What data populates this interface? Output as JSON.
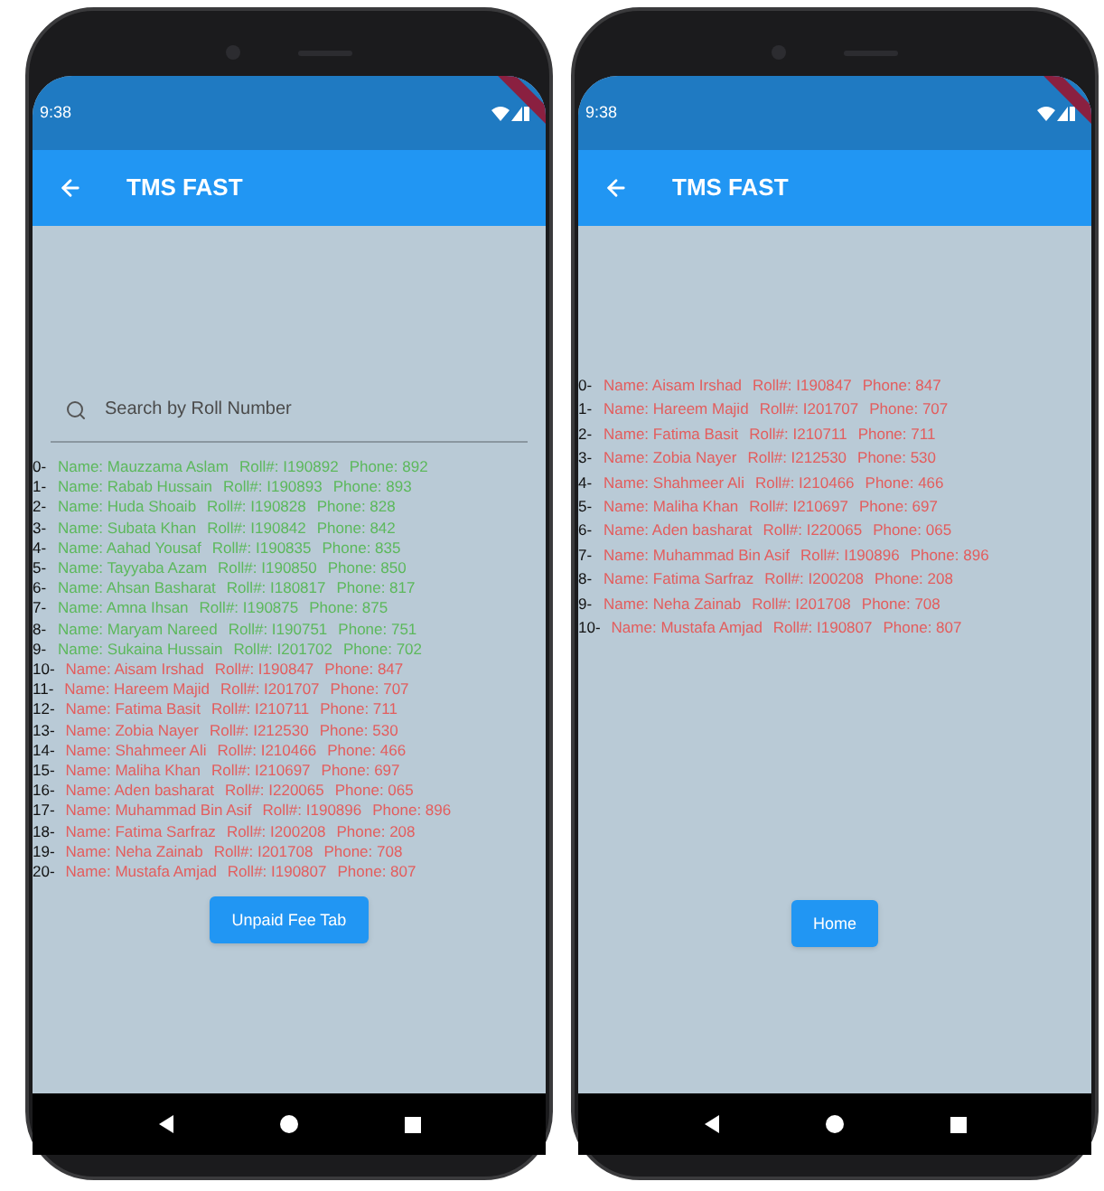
{
  "phones": [
    {
      "status_bar": {
        "time": "9:38"
      },
      "app_bar": {
        "title": "TMS FAST"
      },
      "search": {
        "placeholder": "Search by Roll Number"
      },
      "rows": [
        {
          "index": "0-",
          "name": "Name: Mauzzama Aslam",
          "roll": "Roll#: I190892",
          "phone": "Phone: 892",
          "color": "#5cb85c"
        },
        {
          "index": "1-",
          "name": "Name: Rabab Hussain",
          "roll": "Roll#: I190893",
          "phone": "Phone: 893",
          "color": "#5cb85c"
        },
        {
          "index": "2-",
          "name": "Name: Huda Shoaib",
          "roll": "Roll#: I190828",
          "phone": "Phone: 828",
          "color": "#5cb85c"
        },
        {
          "index": "3-",
          "name": "Name: Subata Khan",
          "roll": "Roll#: I190842",
          "phone": "Phone: 842",
          "color": "#5cb85c"
        },
        {
          "index": "4-",
          "name": "Name: Aahad Yousaf",
          "roll": "Roll#: I190835",
          "phone": "Phone: 835",
          "color": "#5cb85c"
        },
        {
          "index": "5-",
          "name": "Name: Tayyaba Azam",
          "roll": "Roll#: I190850",
          "phone": "Phone: 850",
          "color": "#5cb85c"
        },
        {
          "index": "6-",
          "name": "Name: Ahsan Basharat",
          "roll": "Roll#: I180817",
          "phone": "Phone: 817",
          "color": "#5cb85c"
        },
        {
          "index": "7-",
          "name": "Name: Amna Ihsan",
          "roll": "Roll#: I190875",
          "phone": "Phone: 875",
          "color": "#5cb85c"
        },
        {
          "index": "8-",
          "name": "Name: Maryam Nareed",
          "roll": "Roll#: I190751",
          "phone": "Phone: 751",
          "color": "#5cb85c"
        },
        {
          "index": "9-",
          "name": "Name: Sukaina Hussain",
          "roll": "Roll#: I201702",
          "phone": "Phone: 702",
          "color": "#5cb85c"
        },
        {
          "index": "10-",
          "name": "Name: Aisam Irshad",
          "roll": "Roll#: I190847",
          "phone": "Phone: 847",
          "color": "#e35d5d"
        },
        {
          "index": "11-",
          "name": "Name: Hareem Majid",
          "roll": "Roll#: I201707",
          "phone": "Phone: 707",
          "color": "#e35d5d"
        },
        {
          "index": "12-",
          "name": "Name: Fatima Basit",
          "roll": "Roll#: I210711",
          "phone": "Phone: 711",
          "color": "#e35d5d"
        },
        {
          "index": "13-",
          "name": "Name: Zobia Nayer",
          "roll": "Roll#: I212530",
          "phone": "Phone: 530",
          "color": "#e35d5d"
        },
        {
          "index": "14-",
          "name": "Name: Shahmeer Ali",
          "roll": "Roll#: I210466",
          "phone": "Phone: 466",
          "color": "#e35d5d"
        },
        {
          "index": "15-",
          "name": "Name: Maliha Khan",
          "roll": "Roll#: I210697",
          "phone": "Phone: 697",
          "color": "#e35d5d"
        },
        {
          "index": "16-",
          "name": "Name: Aden basharat",
          "roll": "Roll#: I220065",
          "phone": "Phone: 065",
          "color": "#e35d5d"
        },
        {
          "index": "17-",
          "name": "Name: Muhammad Bin Asif",
          "roll": "Roll#: I190896",
          "phone": "Phone: 896",
          "color": "#e35d5d"
        },
        {
          "index": "18-",
          "name": "Name: Fatima Sarfraz",
          "roll": "Roll#: I200208",
          "phone": "Phone: 208",
          "color": "#e35d5d"
        },
        {
          "index": "19-",
          "name": "Name: Neha Zainab",
          "roll": "Roll#: I201708",
          "phone": "Phone: 708",
          "color": "#e35d5d"
        },
        {
          "index": "20-",
          "name": "Name: Mustafa Amjad",
          "roll": "Roll#: I190807",
          "phone": "Phone: 807",
          "color": "#e35d5d"
        }
      ],
      "button": "Unpaid Fee Tab"
    },
    {
      "status_bar": {
        "time": "9:38"
      },
      "app_bar": {
        "title": "TMS FAST"
      },
      "rows": [
        {
          "index": "0-",
          "name": "Name: Aisam Irshad",
          "roll": "Roll#: I190847",
          "phone": "Phone: 847",
          "color": "#e35d5d"
        },
        {
          "index": "1-",
          "name": "Name: Hareem Majid",
          "roll": "Roll#: I201707",
          "phone": "Phone: 707",
          "color": "#e35d5d"
        },
        {
          "index": "2-",
          "name": "Name: Fatima Basit",
          "roll": "Roll#: I210711",
          "phone": "Phone: 711",
          "color": "#e35d5d"
        },
        {
          "index": "3-",
          "name": "Name: Zobia Nayer",
          "roll": "Roll#: I212530",
          "phone": "Phone: 530",
          "color": "#e35d5d"
        },
        {
          "index": "4-",
          "name": "Name: Shahmeer Ali",
          "roll": "Roll#: I210466",
          "phone": "Phone: 466",
          "color": "#e35d5d"
        },
        {
          "index": "5-",
          "name": "Name: Maliha Khan",
          "roll": "Roll#: I210697",
          "phone": "Phone: 697",
          "color": "#e35d5d"
        },
        {
          "index": "6-",
          "name": "Name: Aden basharat",
          "roll": "Roll#: I220065",
          "phone": "Phone: 065",
          "color": "#e35d5d"
        },
        {
          "index": "7-",
          "name": "Name: Muhammad Bin Asif",
          "roll": "Roll#: I190896",
          "phone": "Phone: 896",
          "color": "#e35d5d"
        },
        {
          "index": "8-",
          "name": "Name: Fatima Sarfraz",
          "roll": "Roll#: I200208",
          "phone": "Phone: 208",
          "color": "#e35d5d"
        },
        {
          "index": "9-",
          "name": "Name: Neha Zainab",
          "roll": "Roll#: I201708",
          "phone": "Phone: 708",
          "color": "#e35d5d"
        },
        {
          "index": "10-",
          "name": "Name: Mustafa Amjad",
          "roll": "Roll#: I190807",
          "phone": "Phone: 807",
          "color": "#e35d5d"
        }
      ],
      "button": "Home"
    }
  ]
}
